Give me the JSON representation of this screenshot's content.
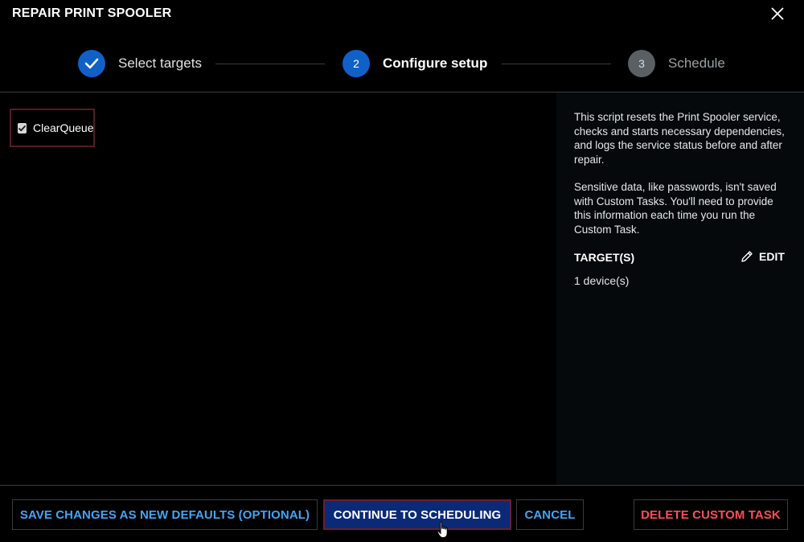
{
  "dialog": {
    "title": "REPAIR PRINT SPOOLER"
  },
  "stepper": {
    "steps": [
      {
        "number": "1",
        "label": "Select targets",
        "state": "done"
      },
      {
        "number": "2",
        "label": "Configure setup",
        "state": "active"
      },
      {
        "number": "3",
        "label": "Schedule",
        "state": "pending"
      }
    ]
  },
  "options": {
    "clear_queue": {
      "label": "ClearQueue",
      "checked": true
    }
  },
  "side": {
    "description": "This script resets the Print Spooler service, checks and starts necessary dependencies, and logs the service status before and after repair.",
    "note": "Sensitive data, like passwords, isn't saved with Custom Tasks. You'll need to provide this information each time you run the Custom Task.",
    "targets_heading": "TARGET(S)",
    "edit_label": "EDIT",
    "targets_value": "1 device(s)"
  },
  "footer": {
    "save_label": "SAVE CHANGES AS NEW DEFAULTS (OPTIONAL)",
    "continue_label": "CONTINUE TO SCHEDULING",
    "cancel_label": "CANCEL",
    "delete_label": "DELETE CUSTOM TASK"
  },
  "colors": {
    "accent_blue": "#1060c8",
    "link_blue": "#42a5f5",
    "danger_red": "#ff4d5a",
    "primary_button": "#0a2a78"
  }
}
